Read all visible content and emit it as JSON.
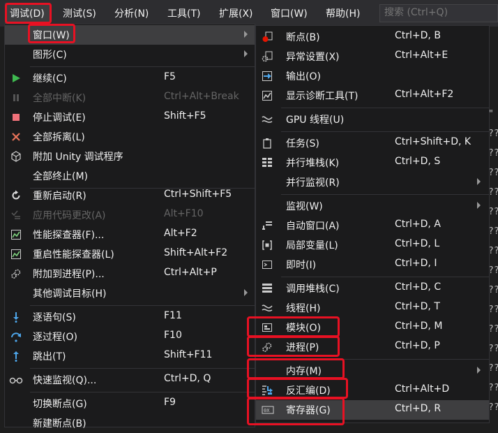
{
  "menubar": {
    "items": [
      "调试(D)",
      "测试(S)",
      "分析(N)",
      "工具(T)",
      "扩展(X)",
      "窗口(W)",
      "帮助(H)"
    ],
    "search_placeholder": "搜索 (Ctrl+Q)"
  },
  "debug_menu": {
    "items": [
      {
        "label": "窗口(W)",
        "shortcut": ""
      },
      {
        "label": "图形(C)",
        "shortcut": ""
      },
      {
        "label": "继续(C)",
        "shortcut": "F5"
      },
      {
        "label": "全部中断(K)",
        "shortcut": "Ctrl+Alt+Break"
      },
      {
        "label": "停止调试(E)",
        "shortcut": "Shift+F5"
      },
      {
        "label": "全部拆离(L)",
        "shortcut": ""
      },
      {
        "label": "附加 Unity 调试程序",
        "shortcut": ""
      },
      {
        "label": "全部终止(M)",
        "shortcut": ""
      },
      {
        "label": "重新启动(R)",
        "shortcut": "Ctrl+Shift+F5"
      },
      {
        "label": "应用代码更改(A)",
        "shortcut": "Alt+F10"
      },
      {
        "label": "性能探查器(F)...",
        "shortcut": "Alt+F2"
      },
      {
        "label": "重启性能探查器(L)",
        "shortcut": "Shift+Alt+F2"
      },
      {
        "label": "附加到进程(P)...",
        "shortcut": "Ctrl+Alt+P"
      },
      {
        "label": "其他调试目标(H)",
        "shortcut": ""
      },
      {
        "label": "逐语句(S)",
        "shortcut": "F11"
      },
      {
        "label": "逐过程(O)",
        "shortcut": "F10"
      },
      {
        "label": "跳出(T)",
        "shortcut": "Shift+F11"
      },
      {
        "label": "快速监视(Q)...",
        "shortcut": "Ctrl+D, Q"
      },
      {
        "label": "切换断点(G)",
        "shortcut": "F9"
      },
      {
        "label": "新建断点(B)",
        "shortcut": ""
      }
    ]
  },
  "window_submenu": {
    "items": [
      {
        "label": "断点(B)",
        "shortcut": "Ctrl+D, B"
      },
      {
        "label": "异常设置(X)",
        "shortcut": "Ctrl+Alt+E"
      },
      {
        "label": "输出(O)",
        "shortcut": ""
      },
      {
        "label": "显示诊断工具(T)",
        "shortcut": "Ctrl+Alt+F2"
      },
      {
        "label": "GPU 线程(U)",
        "shortcut": ""
      },
      {
        "label": "任务(S)",
        "shortcut": "Ctrl+Shift+D, K"
      },
      {
        "label": "并行堆栈(K)",
        "shortcut": "Ctrl+D, S"
      },
      {
        "label": "并行监视(R)",
        "shortcut": ""
      },
      {
        "label": "监视(W)",
        "shortcut": ""
      },
      {
        "label": "自动窗口(A)",
        "shortcut": "Ctrl+D, A"
      },
      {
        "label": "局部变量(L)",
        "shortcut": "Ctrl+D, L"
      },
      {
        "label": "即时(I)",
        "shortcut": "Ctrl+D, I"
      },
      {
        "label": "调用堆栈(C)",
        "shortcut": "Ctrl+D, C"
      },
      {
        "label": "线程(H)",
        "shortcut": "Ctrl+D, T"
      },
      {
        "label": "模块(O)",
        "shortcut": "Ctrl+D, M"
      },
      {
        "label": "进程(P)",
        "shortcut": "Ctrl+D, P"
      },
      {
        "label": "内存(M)",
        "shortcut": ""
      },
      {
        "label": "反汇编(D)",
        "shortcut": "Ctrl+Alt+D"
      },
      {
        "label": "寄存器(G)",
        "shortcut": "Ctrl+D, R"
      }
    ]
  },
  "background_code": [
    "\"",
    "??",
    "??",
    "??",
    "??",
    "??",
    "??",
    "??",
    "??",
    "??",
    "??",
    "??",
    "??",
    "??",
    "??",
    "??"
  ],
  "colors": {
    "highlight_box": "#e81123",
    "menu_bg": "#1b1b1c",
    "hover": "#3e3e40"
  }
}
